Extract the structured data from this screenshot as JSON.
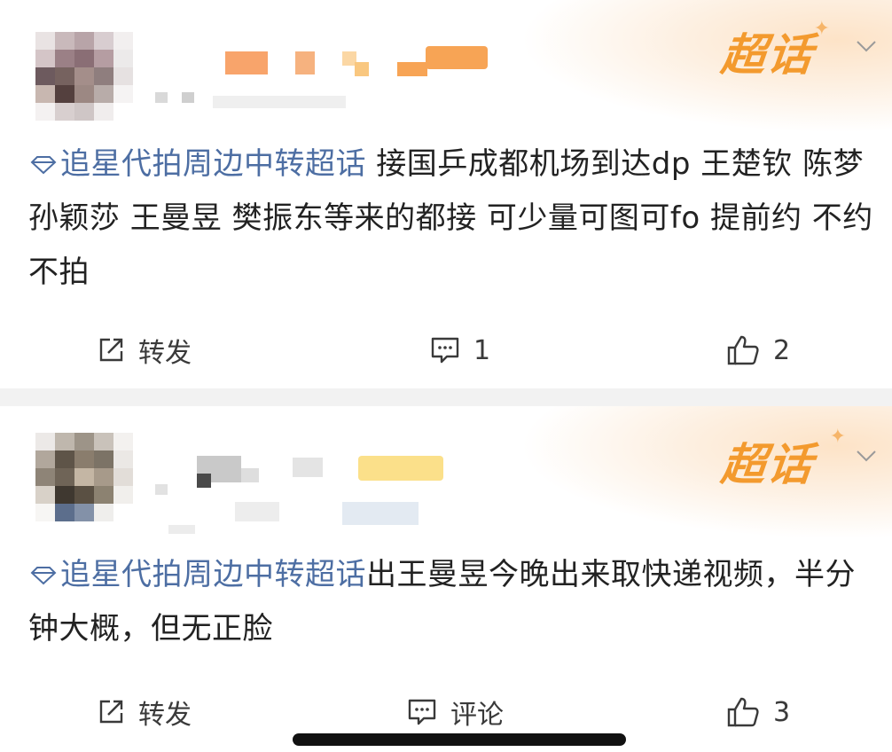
{
  "posts": [
    {
      "badge": "超话",
      "topic": "追星代拍周边中转超话",
      "text": " 接国乒成都机场到达dp 王楚钦 陈梦 孙颖莎 王曼昱 樊振东等来的都接 可少量可图可fo 提前约 不约不拍",
      "repost_label": "转发",
      "comment_label": "1",
      "like_count": "2"
    },
    {
      "badge": "超话",
      "topic": "追星代拍周边中转超话",
      "text": "出王曼昱今晚出来取快递视频，半分钟大概，但无正脸",
      "repost_label": "转发",
      "comment_label": "评论",
      "like_count": "3"
    }
  ],
  "colors": {
    "badge": "#f39a2e",
    "topic_link": "#4d6ea3",
    "divider": "#f2f2f2"
  },
  "icons": [
    "chevron-down-icon",
    "diamond-icon",
    "repost-icon",
    "comment-icon",
    "like-icon"
  ]
}
